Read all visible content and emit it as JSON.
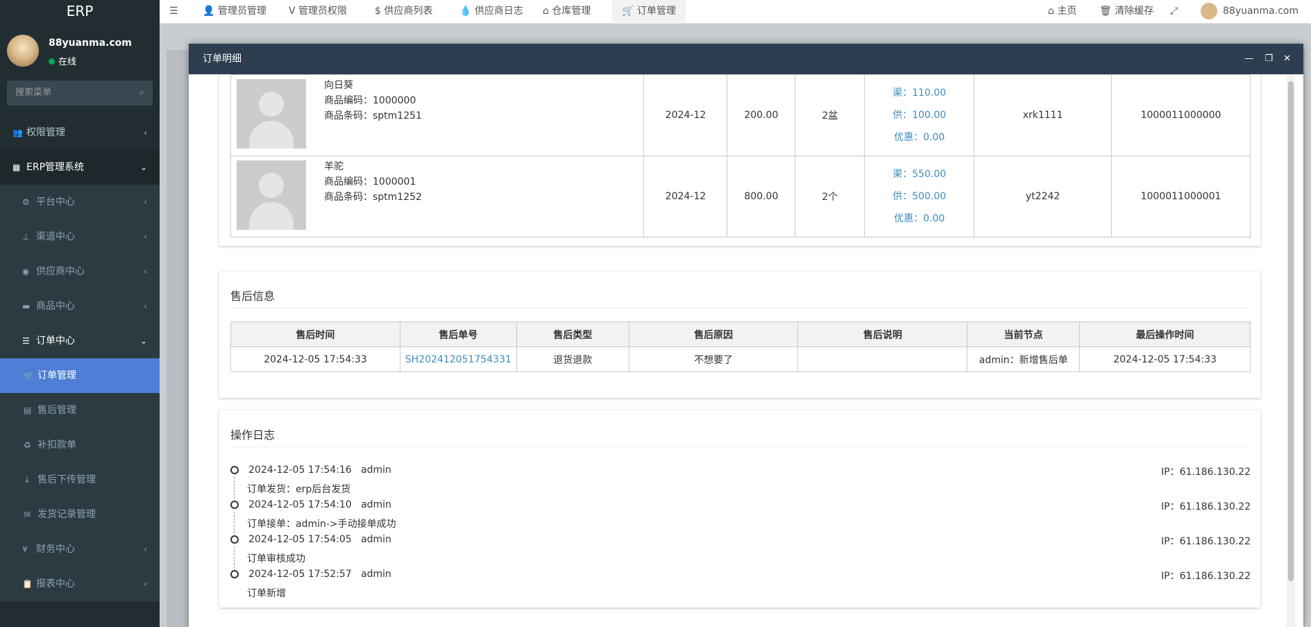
{
  "sidebar": {
    "brand": "ERP",
    "user_name": "88yuanma.com",
    "status": "在线",
    "search_placeholder": "搜索菜单",
    "items": [
      {
        "label": "权限管理",
        "icon": "users-icon"
      },
      {
        "label": "ERP管理系统",
        "icon": "grid-icon"
      },
      {
        "label": "平台中心",
        "icon": "gear-icon"
      },
      {
        "label": "渠道中心",
        "icon": "sitemap-icon"
      },
      {
        "label": "供应商中心",
        "icon": "compass-icon"
      },
      {
        "label": "商品中心",
        "icon": "briefcase-icon"
      },
      {
        "label": "订单中心",
        "icon": "list-icon"
      },
      {
        "label": "订单管理",
        "icon": "cart-icon"
      },
      {
        "label": "售后管理",
        "icon": "list-alt-icon"
      },
      {
        "label": "补扣款单",
        "icon": "recycle-icon"
      },
      {
        "label": "售后下传管理",
        "icon": "arrow-down-icon"
      },
      {
        "label": "发货记录管理",
        "icon": "envelope-icon"
      },
      {
        "label": "财务中心",
        "icon": "yen-icon"
      },
      {
        "label": "报表中心",
        "icon": "clipboard-icon"
      }
    ]
  },
  "topbar": {
    "tabs": [
      "管理员管理",
      "管理员权限",
      "供应商列表",
      "供应商日志",
      "仓库管理",
      "订单管理"
    ],
    "home": "主页",
    "clear_cache": "清除缓存",
    "user": "88yuanma.com"
  },
  "modal": {
    "title": "订单明细",
    "products": [
      {
        "name": "向日葵",
        "code_label": "商品编码：",
        "code": "1000000",
        "barcode_label": "商品条码：",
        "barcode": "sptm1251",
        "date": "2024-12",
        "price": "200.00",
        "qty": "2盆",
        "channel": "渠：110.00",
        "supply": "供：100.00",
        "discount": "优惠：0.00",
        "sku": "xrk1111",
        "id": "1000011000000"
      },
      {
        "name": "羊驼",
        "code_label": "商品编码：",
        "code": "1000001",
        "barcode_label": "商品条码：",
        "barcode": "sptm1252",
        "date": "2024-12",
        "price": "800.00",
        "qty": "2个",
        "channel": "渠：550.00",
        "supply": "供：500.00",
        "discount": "优惠：0.00",
        "sku": "yt2242",
        "id": "1000011000001"
      }
    ],
    "after_sales": {
      "title": "售后信息",
      "headers": [
        "售后时间",
        "售后单号",
        "售后类型",
        "售后原因",
        "售后说明",
        "当前节点",
        "最后操作时间"
      ],
      "row": [
        "2024-12-05 17:54:33",
        "SH202412051754331",
        "退货退款",
        "不想要了",
        "",
        "admin：新增售后单",
        "2024-12-05 17:54:33"
      ]
    },
    "logs": {
      "title": "操作日志",
      "items": [
        {
          "time": "2024-12-05 17:54:16",
          "user": "admin",
          "ip": "IP：61.186.130.22",
          "desc": "订单发货：erp后台发货"
        },
        {
          "time": "2024-12-05 17:54:10",
          "user": "admin",
          "ip": "IP：61.186.130.22",
          "desc": "订单接单：admin->手动接单成功"
        },
        {
          "time": "2024-12-05 17:54:05",
          "user": "admin",
          "ip": "IP：61.186.130.22",
          "desc": "订单审核成功"
        },
        {
          "time": "2024-12-05 17:52:57",
          "user": "admin",
          "ip": "IP：61.186.130.22",
          "desc": "订单新增"
        }
      ]
    }
  }
}
